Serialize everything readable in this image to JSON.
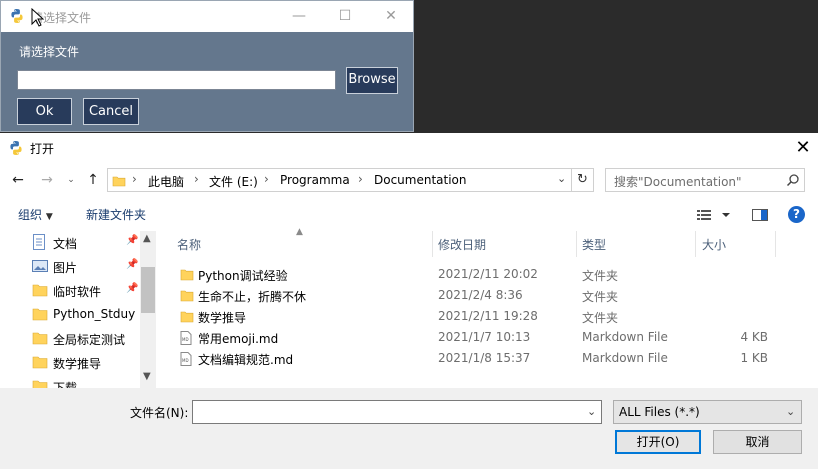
{
  "sg_dialog": {
    "title": "请选择文件",
    "label": "请选择文件",
    "input_value": "",
    "browse_label": "Browse",
    "ok_label": "Ok",
    "cancel_label": "Cancel",
    "colors": {
      "background": "#64778d",
      "button": "#283b5b"
    }
  },
  "file_dialog": {
    "title": "打开",
    "address": {
      "breadcrumbs": [
        "此电脑",
        "文件 (E:)",
        "Programma",
        "Documentation"
      ]
    },
    "search_placeholder": "搜索\"Documentation\"",
    "toolbar": {
      "organize": "组织",
      "new_folder": "新建文件夹"
    },
    "nav_items": [
      {
        "label": "文档",
        "icon": "document-icon",
        "pinned": true
      },
      {
        "label": "图片",
        "icon": "picture-icon",
        "pinned": true
      },
      {
        "label": "临时软件",
        "icon": "folder-icon",
        "pinned": true
      },
      {
        "label": "Python_Stduy",
        "icon": "folder-icon",
        "pinned": false
      },
      {
        "label": "全局标定测试",
        "icon": "folder-icon",
        "pinned": false
      },
      {
        "label": "数学推导",
        "icon": "folder-icon",
        "pinned": false
      },
      {
        "label": "下载",
        "icon": "folder-icon",
        "pinned": false
      }
    ],
    "columns": {
      "name": "名称",
      "date": "修改日期",
      "type": "类型",
      "size": "大小"
    },
    "files": [
      {
        "name": "Python调试经验",
        "date": "2021/2/11 20:02",
        "type": "文件夹",
        "size": "",
        "icon": "folder-icon"
      },
      {
        "name": "生命不止，折腾不休",
        "date": "2021/2/4 8:36",
        "type": "文件夹",
        "size": "",
        "icon": "folder-icon"
      },
      {
        "name": "数学推导",
        "date": "2021/2/11 19:28",
        "type": "文件夹",
        "size": "",
        "icon": "folder-icon"
      },
      {
        "name": "常用emoji.md",
        "date": "2021/1/7 10:13",
        "type": "Markdown File",
        "size": "4 KB",
        "icon": "markdown-file-icon"
      },
      {
        "name": "文档编辑规范.md",
        "date": "2021/1/8 15:37",
        "type": "Markdown File",
        "size": "1 KB",
        "icon": "markdown-file-icon"
      }
    ],
    "filename_label": "文件名(N):",
    "filename_value": "",
    "filetype_value": "ALL Files (*.*)",
    "open_label": "打开(O)",
    "cancel_label": "取消"
  }
}
